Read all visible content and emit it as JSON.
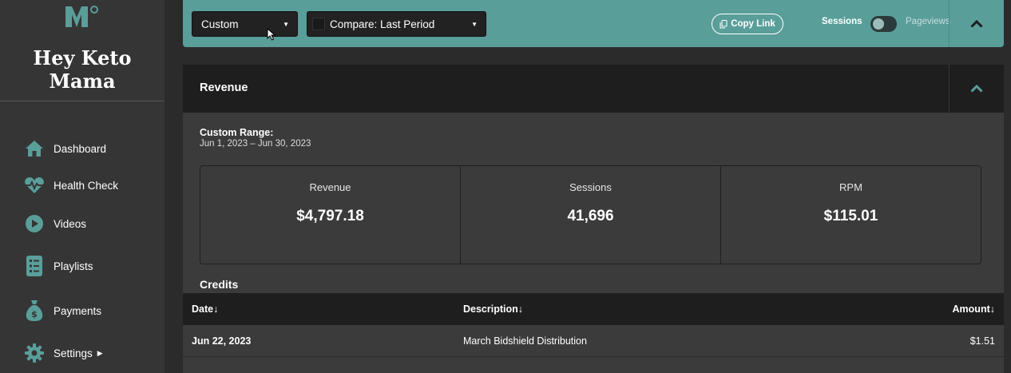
{
  "sidebar": {
    "brand_line1": "Hey Keto",
    "brand_line2": "Mama",
    "items": [
      {
        "label": "Dashboard",
        "icon": "home-icon"
      },
      {
        "label": "Health Check",
        "icon": "heart-pulse-icon"
      },
      {
        "label": "Videos",
        "icon": "play-icon"
      },
      {
        "label": "Playlists",
        "icon": "list-icon"
      },
      {
        "label": "Payments",
        "icon": "money-bag-icon"
      },
      {
        "label": "Settings",
        "icon": "gear-icon"
      }
    ]
  },
  "toolbar": {
    "range_select": "Custom",
    "compare_select": "Compare: Last Period",
    "copy_link": "Copy Link",
    "toggle_on_label": "Sessions",
    "toggle_off_label": "Pageviews"
  },
  "panel": {
    "title": "Revenue",
    "range_label": "Custom Range:",
    "range_value": "Jun 1, 2023 – Jun 30, 2023",
    "stats": [
      {
        "label": "Revenue",
        "value": "$4,797.18"
      },
      {
        "label": "Sessions",
        "value": "41,696"
      },
      {
        "label": "RPM",
        "value": "$115.01"
      }
    ],
    "credits_title": "Credits",
    "table": {
      "headers": {
        "date": "Date↓",
        "description": "Description↓",
        "amount": "Amount↓"
      },
      "rows": [
        {
          "date": "Jun 22, 2023",
          "description": "March Bidshield Distribution",
          "amount": "$1.51"
        }
      ]
    }
  },
  "colors": {
    "accent": "#5a9e9a",
    "sidebar_bg": "#353535",
    "panel_bg": "#3b3b3b",
    "header_bg": "#1e1e1f",
    "icon_teal": "#5a9e9a"
  }
}
